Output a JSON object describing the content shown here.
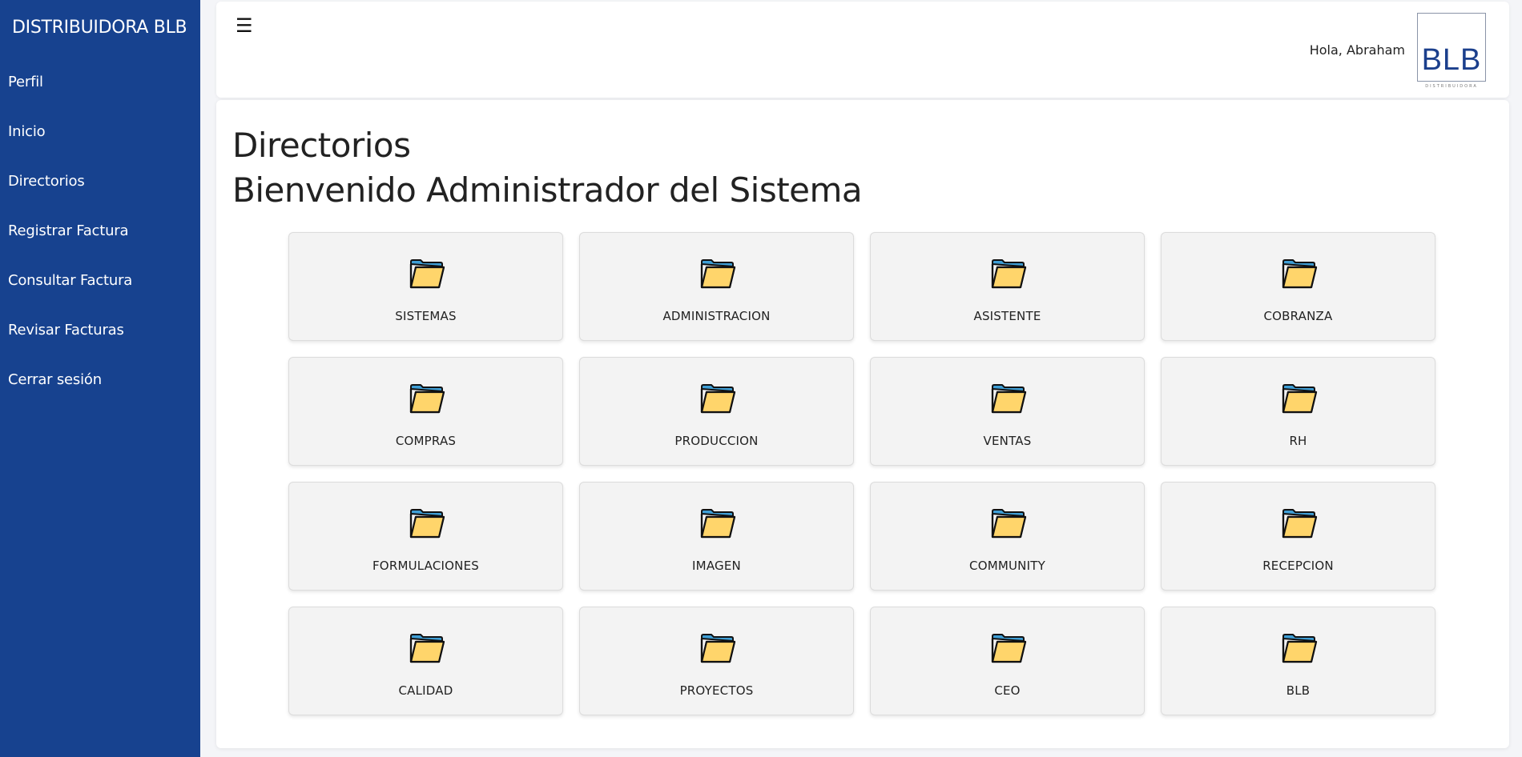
{
  "sidebar": {
    "brand": "DISTRIBUIDORA BLB",
    "items": [
      {
        "label": "Perfil"
      },
      {
        "label": "Inicio"
      },
      {
        "label": "Directorios"
      },
      {
        "label": "Registrar Factura"
      },
      {
        "label": "Consultar Factura"
      },
      {
        "label": "Revisar Facturas"
      },
      {
        "label": "Cerrar sesión"
      }
    ]
  },
  "header": {
    "menu_icon": "☰",
    "greeting": "Hola, Abraham",
    "logo_text": "BLB",
    "logo_subtext": "DISTRIBUIDORA"
  },
  "main": {
    "title": "Directorios",
    "subtitle": "Bienvenido Administrador del Sistema",
    "folders": [
      {
        "label": "SISTEMAS",
        "icon": "folder-icon"
      },
      {
        "label": "ADMINISTRACION",
        "icon": "folder-icon"
      },
      {
        "label": "ASISTENTE",
        "icon": "folder-icon"
      },
      {
        "label": "COBRANZA",
        "icon": "folder-icon"
      },
      {
        "label": "COMPRAS",
        "icon": "folder-icon"
      },
      {
        "label": "PRODUCCION",
        "icon": "folder-icon"
      },
      {
        "label": "VENTAS",
        "icon": "folder-icon"
      },
      {
        "label": "RH",
        "icon": "folder-icon"
      },
      {
        "label": "FORMULACIONES",
        "icon": "folder-icon"
      },
      {
        "label": "IMAGEN",
        "icon": "folder-icon"
      },
      {
        "label": "COMMUNITY",
        "icon": "folder-icon"
      },
      {
        "label": "RECEPCION",
        "icon": "folder-icon"
      },
      {
        "label": "CALIDAD",
        "icon": "folder-icon"
      },
      {
        "label": "PROYECTOS",
        "icon": "folder-icon"
      },
      {
        "label": "CEO",
        "icon": "folder-icon"
      },
      {
        "label": "BLB",
        "icon": "folder-icon"
      }
    ]
  },
  "colors": {
    "sidebar_bg": "#17428f",
    "card_bg": "#f3f3f3",
    "folder_fill": "#ffd56b",
    "folder_tab": "#3f9fd6"
  }
}
